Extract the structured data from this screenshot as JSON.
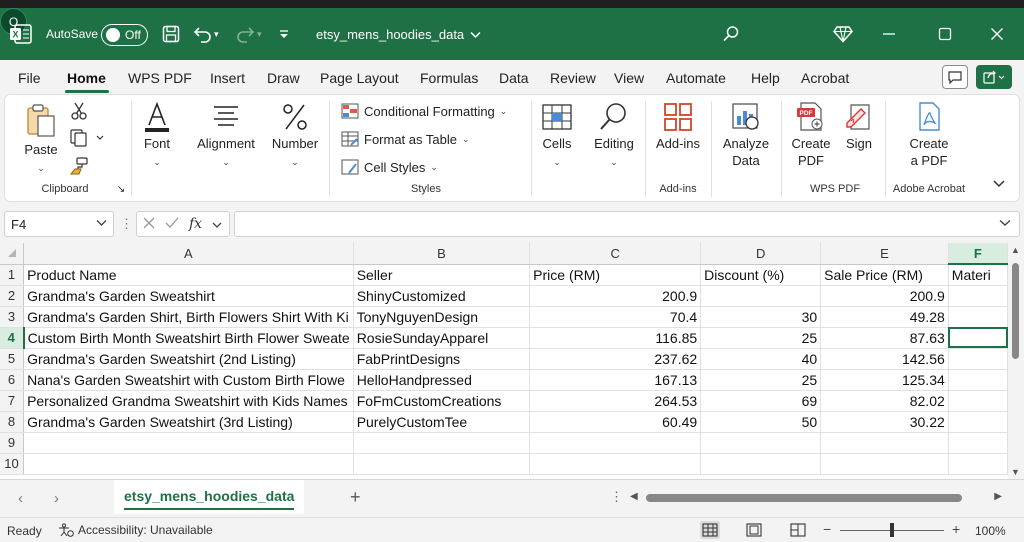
{
  "titlebar": {
    "autosave_label": "AutoSave",
    "autosave_state": "Off",
    "doc_title": "etsy_mens_hoodies_data",
    "avatar_initial": "O",
    "accent_color": "#1e7145"
  },
  "tabs": [
    "File",
    "Home",
    "WPS PDF",
    "Insert",
    "Draw",
    "Page Layout",
    "Formulas",
    "Data",
    "Review",
    "View",
    "Automate",
    "Help",
    "Acrobat"
  ],
  "active_tab": "Home",
  "ribbon": {
    "clipboard": {
      "paste": "Paste",
      "group": "Clipboard"
    },
    "font": "Font",
    "alignment": "Alignment",
    "number": "Number",
    "styles": {
      "conditional": "Conditional Formatting",
      "format_table": "Format as Table",
      "cell_styles": "Cell Styles",
      "group": "Styles"
    },
    "cells": "Cells",
    "editing": "Editing",
    "addins": {
      "btn": "Add-ins",
      "group": "Add-ins"
    },
    "analyze": {
      "line1": "Analyze",
      "line2": "Data"
    },
    "wps": {
      "create1": "Create",
      "create2": "PDF",
      "sign": "Sign",
      "group": "WPS PDF"
    },
    "acrobat": {
      "line1": "Create",
      "line2": "a PDF",
      "group": "Adobe Acrobat"
    }
  },
  "formula_bar": {
    "name_box": "F4",
    "fx": "fx",
    "formula": ""
  },
  "sheet": {
    "columns": [
      "A",
      "B",
      "C",
      "D",
      "E",
      "F"
    ],
    "selected_column": "F",
    "selected_row": 4,
    "row_numbers": [
      "1",
      "2",
      "3",
      "4",
      "5",
      "6",
      "7",
      "8",
      "9",
      "10"
    ],
    "header_row": [
      "Product Name",
      "Seller",
      "Price (RM)",
      "Discount (%)",
      "Sale Price (RM)",
      "Materi"
    ],
    "rows": [
      [
        "Grandma's Garden Sweatshirt",
        "ShinyCustomized",
        "200.9",
        "",
        "200.9",
        ""
      ],
      [
        "Grandma's Garden Shirt, Birth Flowers Shirt With Ki",
        "TonyNguyenDesign",
        "70.4",
        "30",
        "49.28",
        ""
      ],
      [
        "Custom Birth Month Sweatshirt Birth Flower Sweate",
        "RosieSundayApparel",
        "116.85",
        "25",
        "87.63",
        ""
      ],
      [
        "Grandma's Garden Sweatshirt (2nd Listing)",
        "FabPrintDesigns",
        "237.62",
        "40",
        "142.56",
        ""
      ],
      [
        "Nana's Garden Sweatshirt with Custom Birth Flowe",
        "HelloHandpressed",
        "167.13",
        "25",
        "125.34",
        ""
      ],
      [
        "Personalized Grandma Sweatshirt with Kids Names",
        "FoFmCustomCreations",
        "264.53",
        "69",
        "82.02",
        ""
      ],
      [
        "Grandma's Garden Sweatshirt (3rd Listing)",
        "PurelyCustomTee",
        "60.49",
        "50",
        "30.22",
        ""
      ],
      [
        "",
        "",
        "",
        "",
        "",
        ""
      ],
      [
        "",
        "",
        "",
        "",
        "",
        ""
      ]
    ]
  },
  "sheet_tabs": {
    "active": "etsy_mens_hoodies_data",
    "add": "+"
  },
  "statusbar": {
    "ready": "Ready",
    "accessibility": "Accessibility: Unavailable",
    "zoom": "100%"
  }
}
